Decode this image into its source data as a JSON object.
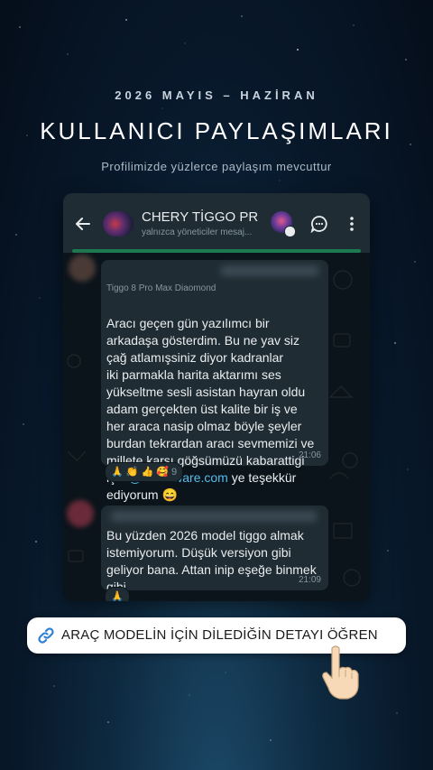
{
  "header": {
    "date_range": "2026 MAYIS – HAZİRAN",
    "title": "KULLANICI PAYLAŞIMLARI",
    "caption": "Profilimizde yüzlerce paylaşım mevcuttur"
  },
  "chat": {
    "title": "CHERY TİGGO PR...",
    "subtitle": "yalnızca yöneticiler mesaj...",
    "icons": {
      "back": "arrow-left-icon",
      "member": "member-avatar",
      "reply": "chat-bubble-icon",
      "menu": "more-vertical-icon"
    },
    "messages": [
      {
        "sender_tag": "Tiggo 8 Pro Max Diaomond",
        "text_before": "Aracı geçen gün yazılımcı bir\narkadaşa gösterdim. Bu ne yav siz\nçağ atlamışsiniz diyor kadranlar\niki parmakla harita aktarımı ses\nyükseltme sesli asistan hayran oldu\nadam gerçekten üst kalite bir iş ve\nher araca nasip olmaz böyle şeyler\nburdan tekrardan aracı sevmemizi ve\nmillete karşı göğsümüzü kabarattigi\niçin ",
        "mention": "@muhaware.com",
        "text_after": " ye teşekkür\nediyorum 😄",
        "time": "21:06",
        "reactions": "🙏 👏 👍 🥰",
        "reaction_count": "9"
      },
      {
        "text": "Bu yüzden 2026 model tiggo almak\nistemiyorum. Düşük versiyon gibi\ngeliyor bana. Attan inip eşeğe binmek\ngibi",
        "time": "21:09",
        "reactions": "🙏"
      }
    ]
  },
  "cta": {
    "label": "ARAÇ MODELİN İÇİN DİLEDİĞİN DETAYI ÖĞREN",
    "icon": "link-icon"
  },
  "pointer": "pointing-hand-icon",
  "colors": {
    "bubble": "#202c33",
    "chat_bg": "#0b141a",
    "header_bg": "#1f2c33",
    "mention": "#53bdeb",
    "cta_icon": "#2f7fd6"
  }
}
